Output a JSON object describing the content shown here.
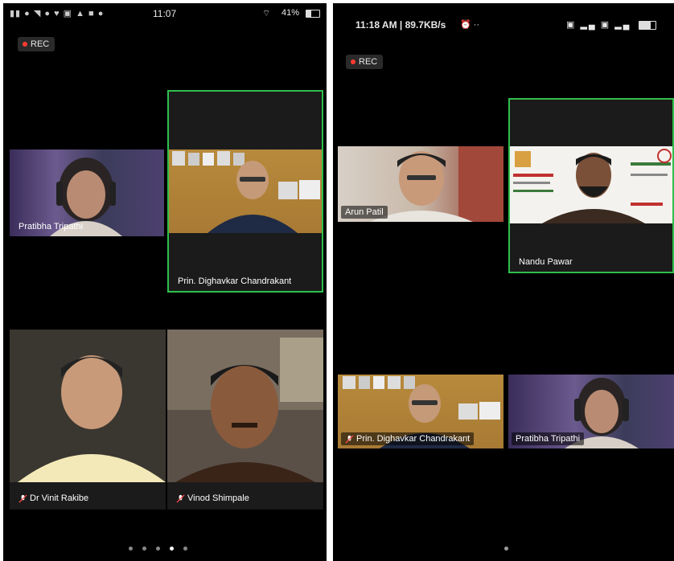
{
  "left_phone": {
    "status": {
      "time": "11:07",
      "battery": "41%"
    },
    "rec_label": "REC",
    "participants": [
      {
        "name": "Pratibha Tripathi",
        "muted": false
      },
      {
        "name": "Prin. Dighavkar Chandrakant",
        "muted": false,
        "active_speaker": true
      },
      {
        "name": "Dr Vinit Rakibe",
        "muted": true
      },
      {
        "name": "Vinod Shimpale",
        "muted": true
      }
    ],
    "pager": {
      "count": 5,
      "active_index": 3
    }
  },
  "right_phone": {
    "status": {
      "time_speed": "11:18 AM | 89.7KB/s"
    },
    "rec_label": "REC",
    "participants": [
      {
        "name": "Arun Patil",
        "muted": false
      },
      {
        "name": "Nandu Pawar",
        "muted": false,
        "active_speaker": true
      },
      {
        "name": "Prin. Dighavkar Chandrakant",
        "muted": true
      },
      {
        "name": "Pratibha Tripathi",
        "muted": false
      }
    ],
    "pager": {
      "count": 1,
      "active_index": 0
    }
  },
  "colors": {
    "active_border": "#2fbf4b",
    "rec_dot": "#ff3b30",
    "background": "#000000"
  }
}
